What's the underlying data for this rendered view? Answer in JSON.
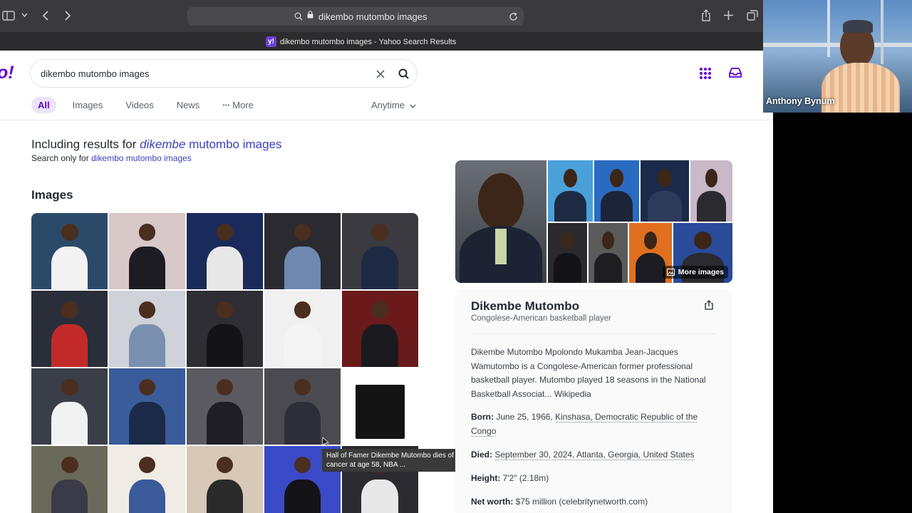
{
  "browser": {
    "url": "dikembo mutombo images",
    "tab_title": "dikembo mutombo images - Yahoo Search Results",
    "favicon_letter": "y!"
  },
  "header": {
    "logo": "o!",
    "search_value": "dikembo mutombo images"
  },
  "tabs": [
    {
      "label": "All",
      "active": true
    },
    {
      "label": "Images",
      "active": false
    },
    {
      "label": "Videos",
      "active": false
    },
    {
      "label": "News",
      "active": false
    },
    {
      "label": "More",
      "active": false
    }
  ],
  "time_filter": "Anytime",
  "spelling": {
    "including_prefix": "Including results for",
    "corrected_italic": "dikembe",
    "corrected_rest": " mutombo images",
    "search_only_prefix": "Search only for",
    "search_only_link": "dikembo mutombo images"
  },
  "images_heading": "Images",
  "tooltip": "Hall of Famer Dikembe Mutombo dies of brain cancer at age 58, NBA ...",
  "knowledge_panel": {
    "more_images": "More images",
    "name": "Dikembe Mutombo",
    "subtitle": "Congolese-American basketball player",
    "description": "Dikembe Mutombo Mpolondo Mukamba Jean-Jacques Wamutombo is a Congolese-American former professional basketball player. Mutombo played 18 seasons in the National Basketball Associat... Wikipedia",
    "born_label": "Born:",
    "born_value": "June 25, 1966, ",
    "born_place": "Kinshasa, Democratic Republic of the Congo",
    "died_label": "Died:",
    "died_value": "September 30, 2024, Atlanta, Georgia, United States",
    "height_label": "Height:",
    "height_value": "7′2″ (2.18m)",
    "networth_label": "Net worth:",
    "networth_value": "$75 million (celebritynetworth.com)"
  },
  "webcam": {
    "name": "Anthony Bynum"
  }
}
